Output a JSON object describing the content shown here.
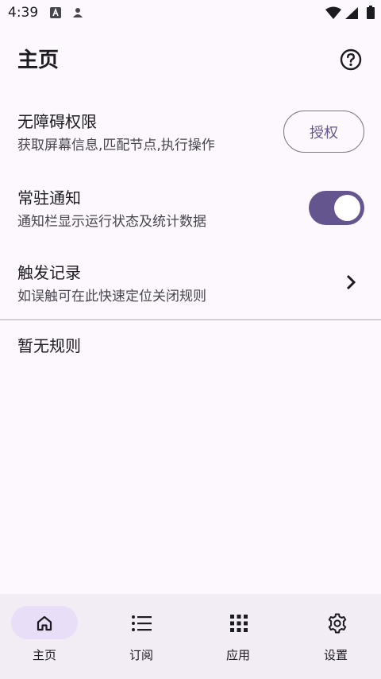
{
  "status_bar": {
    "time": "4:39",
    "icons": [
      "a-notification-icon",
      "person-notification-icon",
      "wifi-icon",
      "signal-icon",
      "battery-icon"
    ]
  },
  "app_bar": {
    "title": "主页",
    "help_icon": "help-circle-icon"
  },
  "settings": {
    "accessibility": {
      "title": "无障碍权限",
      "desc": "获取屏幕信息,匹配节点,执行操作",
      "button": "授权"
    },
    "notification": {
      "title": "常驻通知",
      "desc": "通知栏显示运行状态及统计数据",
      "enabled": true
    },
    "trigger_log": {
      "title": "触发记录",
      "desc": "如误触可在此快速定位关闭规则"
    }
  },
  "rules": {
    "empty_text": "暂无规则"
  },
  "bottom_nav": {
    "items": [
      {
        "label": "主页",
        "icon": "home-icon",
        "active": true
      },
      {
        "label": "订阅",
        "icon": "list-icon",
        "active": false
      },
      {
        "label": "应用",
        "icon": "apps-grid-icon",
        "active": false
      },
      {
        "label": "设置",
        "icon": "gear-icon",
        "active": false
      }
    ]
  },
  "colors": {
    "background": "#fdf8fd",
    "primary": "#65558f",
    "nav_background": "#f2ecf4",
    "nav_active_indicator": "#e8def8"
  }
}
